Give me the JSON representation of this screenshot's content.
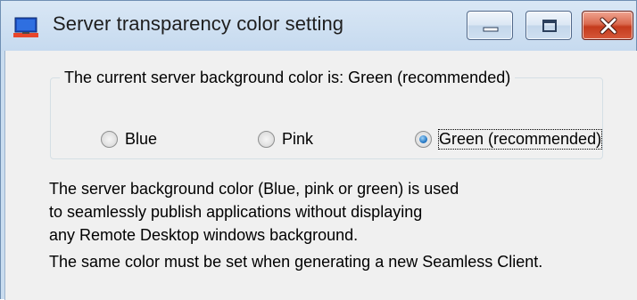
{
  "window": {
    "title": "Server transparency color setting",
    "icon": "monitor-icon",
    "controls": {
      "minimize": "minimize-icon",
      "maximize": "maximize-icon",
      "close": "close-icon",
      "close_color": "#c94a2f"
    }
  },
  "group": {
    "legend": "The current server background color is: Green (recommended)",
    "options": [
      {
        "label": "Blue",
        "checked": false
      },
      {
        "label": "Pink",
        "checked": false
      },
      {
        "label": "Green (recommended)",
        "checked": true
      }
    ]
  },
  "description": {
    "lines": [
      "The server background color (Blue, pink or green) is used",
      "to seamlessly publish applications without displaying",
      "any Remote Desktop windows background."
    ],
    "note": "The same color must be set when generating a new Seamless Client."
  },
  "colors": {
    "titlebar": "#c9dcef",
    "client": "#f0f0f0",
    "radio_selected": "#2a7cc7"
  }
}
